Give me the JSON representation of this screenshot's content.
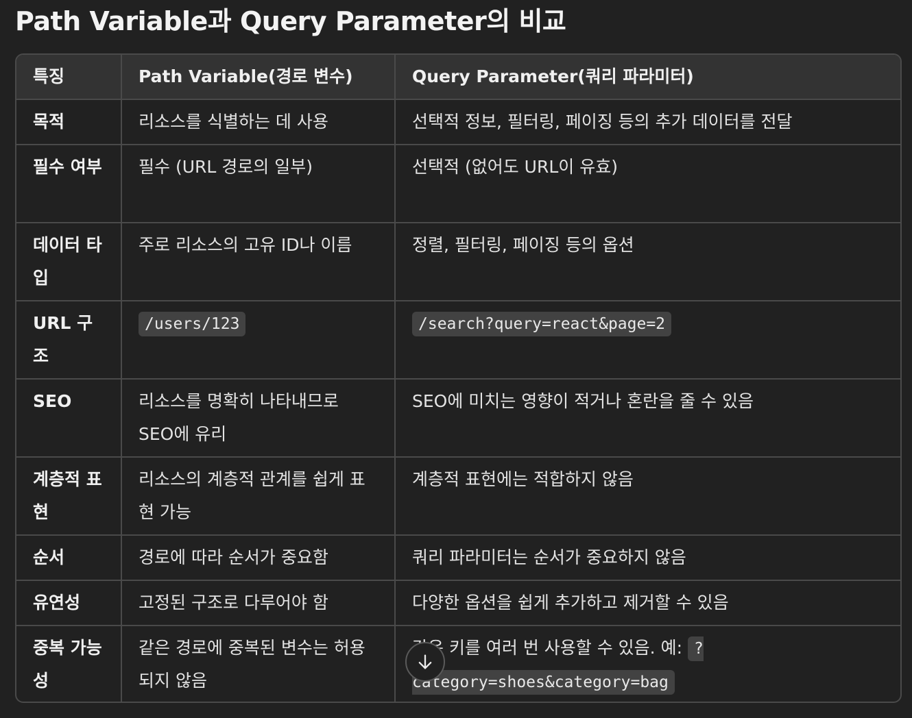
{
  "title": "Path Variable과 Query Parameter의 비교",
  "table": {
    "headers": [
      "특징",
      "Path Variable(경로 변수)",
      "Query Parameter(쿼리 파라미터)"
    ],
    "rows": [
      {
        "feature": "목적",
        "path": "리소스를 식별하는 데 사용",
        "query": "선택적 정보, 필터링, 페이징 등의 추가 데이터를 전달"
      },
      {
        "feature": "필수 여부",
        "path": "필수 (URL 경로의 일부)",
        "query": "선택적 (없어도 URL이 유효)"
      },
      {
        "feature": "데이터 타입",
        "path": "주로 리소스의 고유 ID나 이름",
        "query": "정렬, 필터링, 페이징 등의 옵션"
      },
      {
        "feature": "URL 구조",
        "path_code": "/users/123",
        "query_code": "/search?query=react&page=2"
      },
      {
        "feature": "SEO",
        "path": "리소스를 명확히 나타내므로 SEO에 유리",
        "query": "SEO에 미치는 영향이 적거나 혼란을 줄 수 있음"
      },
      {
        "feature": "계층적 표현",
        "path": "리소스의 계층적 관계를 쉽게 표현 가능",
        "query": "계층적 표현에는 적합하지 않음"
      },
      {
        "feature": "순서",
        "path": "경로에 따라 순서가 중요함",
        "query": "쿼리 파라미터는 순서가 중요하지 않음"
      },
      {
        "feature": "유연성",
        "path": "고정된 구조로 다루어야 함",
        "query": "다양한 옵션을 쉽게 추가하고 제거할 수 있음"
      },
      {
        "feature": "중복 가능성",
        "path": "같은 경로에 중복된 변수는 허용되지 않음",
        "query_prefix": "같은 키를 여러 번 사용할 수 있음. 예: ",
        "query_code": "?category=shoes&category=bag"
      }
    ]
  },
  "scroll_button": {
    "icon": "arrow-down-icon"
  }
}
